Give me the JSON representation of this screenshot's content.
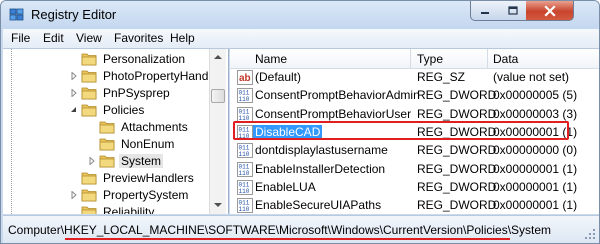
{
  "window": {
    "title": "Registry Editor"
  },
  "menu": [
    "File",
    "Edit",
    "View",
    "Favorites",
    "Help"
  ],
  "tree": [
    {
      "label": "Personalization",
      "expander": "",
      "level": 1
    },
    {
      "label": "PhotoPropertyHandler",
      "expander": "collapsed",
      "level": 1
    },
    {
      "label": "PnPSysprep",
      "expander": "collapsed",
      "level": 1
    },
    {
      "label": "Policies",
      "expander": "expanded",
      "level": 1
    },
    {
      "label": "Attachments",
      "expander": "",
      "level": 2
    },
    {
      "label": "NonEnum",
      "expander": "",
      "level": 2
    },
    {
      "label": "System",
      "expander": "collapsed",
      "level": 2,
      "selected": true
    },
    {
      "label": "PreviewHandlers",
      "expander": "",
      "level": 1
    },
    {
      "label": "PropertySystem",
      "expander": "collapsed",
      "level": 1
    },
    {
      "label": "Reliability",
      "expander": "",
      "level": 1
    }
  ],
  "list": {
    "headers": {
      "name": "Name",
      "type": "Type",
      "data": "Data"
    },
    "rows": [
      {
        "name": "(Default)",
        "type": "REG_SZ",
        "data": "(value not set)",
        "icon": "string-value-icon"
      },
      {
        "name": "ConsentPromptBehaviorAdmin",
        "type": "REG_DWORD",
        "data": "0x00000005 (5)",
        "icon": "dword-value-icon"
      },
      {
        "name": "ConsentPromptBehaviorUser",
        "type": "REG_DWORD",
        "data": "0x00000003 (3)",
        "icon": "dword-value-icon"
      },
      {
        "name": "DisableCAD",
        "type": "REG_DWORD",
        "data": "0x00000001 (1)",
        "icon": "dword-value-icon",
        "selected": true
      },
      {
        "name": "dontdisplaylastusername",
        "type": "REG_DWORD",
        "data": "0x00000000 (0)",
        "icon": "dword-value-icon"
      },
      {
        "name": "EnableInstallerDetection",
        "type": "REG_DWORD",
        "data": "0x00000001 (1)",
        "icon": "dword-value-icon"
      },
      {
        "name": "EnableLUA",
        "type": "REG_DWORD",
        "data": "0x00000001 (1)",
        "icon": "dword-value-icon"
      },
      {
        "name": "EnableSecureUIAPaths",
        "type": "REG_DWORD",
        "data": "0x00000001 (1)",
        "icon": "dword-value-icon"
      }
    ]
  },
  "status": {
    "path": "Computer\\HKEY_LOCAL_MACHINE\\SOFTWARE\\Microsoft\\Windows\\CurrentVersion\\Policies\\System"
  },
  "colors": {
    "selection": "#3399ff",
    "highlight_annotation": "#e02020",
    "folder": "#e8c45a"
  }
}
